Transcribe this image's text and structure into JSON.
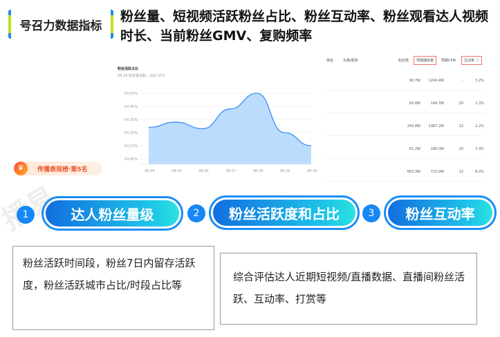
{
  "tag": "号召力数据指标",
  "heading": "粉丝量、短视频活跃粉丝占比、粉丝互动率、粉丝观看达人视频时长、当前粉丝GMV、复购频率",
  "chart_data": {
    "type": "area",
    "title": "粉丝活跃占比",
    "subtitle": "08-28 粉丝最活跃，占比 55%",
    "x": [
      "08-24",
      "08-25",
      "08-26",
      "08-27",
      "08-28",
      "08-29",
      "08-30"
    ],
    "values": [
      54.24,
      54.28,
      54.23,
      54.38,
      54.5,
      54.2,
      54.1
    ],
    "yticks": [
      "54.50%",
      "54.40%",
      "54.30%",
      "54.20%",
      "54.10%",
      "54.00%"
    ],
    "ylim": [
      53.96,
      54.52
    ],
    "grid": true,
    "color": "#3a8ef5"
  },
  "table": {
    "headers": [
      "排名",
      "头像/昵称",
      "粉丝数",
      "预期播放量",
      "预期CPM",
      "互动率 ⓘ"
    ],
    "rows": [
      [
        "90.7W",
        "1204.4W",
        "-",
        "3.2%"
      ],
      [
        "82.8W",
        "149.7W",
        "20",
        "1.3%"
      ],
      [
        "243.8W",
        "1387.2W",
        "12",
        "2.2%"
      ],
      [
        "61.2W",
        "186.0W",
        "10",
        "1.4%"
      ],
      [
        "663.3W",
        "715.0W",
        "13",
        "6.0%"
      ]
    ]
  },
  "badge": {
    "icon": "crown-icon",
    "label": "传播表现榜·第5名"
  },
  "steps": [
    {
      "num": "1",
      "label": "达人粉丝量级"
    },
    {
      "num": "2",
      "label": "粉丝活跃度和占比"
    },
    {
      "num": "3",
      "label": "粉丝互动率"
    }
  ],
  "desc1": "粉丝活跃时间段，粉丝7日内留存活跃度，粉丝活跃城市占比/时段占比等",
  "desc2": "综合评估达人近期短视频/直播数据、直播间粉丝活跃、互动率、打赏等"
}
